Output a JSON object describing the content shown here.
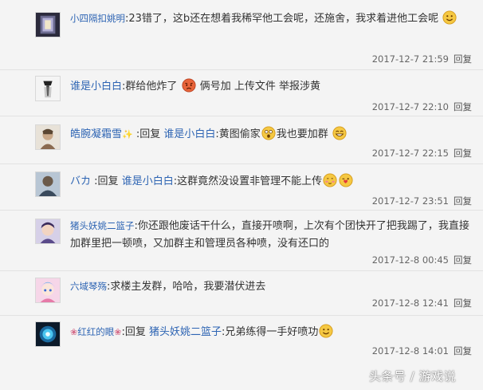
{
  "reply_label": "回复",
  "comments": [
    {
      "user": "小四隔扣姚明",
      "text": ":23错了，这b还在想着我稀罕他工会呢，还施舍，我求着进他工会呢",
      "time": "2017-12-7 21:59",
      "emoji_after": [
        "smile"
      ]
    },
    {
      "user": "谁是小白白",
      "text_a": ":群给他炸了",
      "text_b": "俩号加 上传文件 举报涉黄",
      "time": "2017-12-7 22:10",
      "emoji_mid": [
        "angry"
      ]
    },
    {
      "user": "皓腕凝霜雪",
      "reply_word": ":回复",
      "target": "谁是小白白",
      "text_a": ":黄图偷家",
      "text_b": "我也要加群",
      "time": "2017-12-7 22:15",
      "emoji_mid": [
        "shocked"
      ],
      "emoji_after": [
        "grin"
      ]
    },
    {
      "user": "バカ",
      "reply_word": ":回复",
      "target": "谁是小白白",
      "text": ":这群竟然没设置非管理不能上传",
      "time": "2017-12-7 23:51",
      "emoji_after": [
        "shy",
        "kiss"
      ]
    },
    {
      "user": "猪头妖姚二篮子",
      "text": ":你还跟他废话干什么，直接开喷啊，上次有个团快开了把我踢了，我直接加群里把一顿喷，又加群主和管理员各种喷，没有还口的",
      "time": "2017-12-8 00:45"
    },
    {
      "user": "六域琴殇",
      "text": ":求楼主发群，哈哈，我要潜伏进去",
      "time": "2017-12-8 12:41"
    },
    {
      "user": "红红的眼",
      "reply_word": ":回复",
      "target": "猪头妖姚二篮子",
      "text": ":兄弟练得一手好喷功",
      "time": "2017-12-8 14:01",
      "emoji_after": [
        "smile"
      ]
    }
  ],
  "watermark": "头条号 / 游戏说"
}
